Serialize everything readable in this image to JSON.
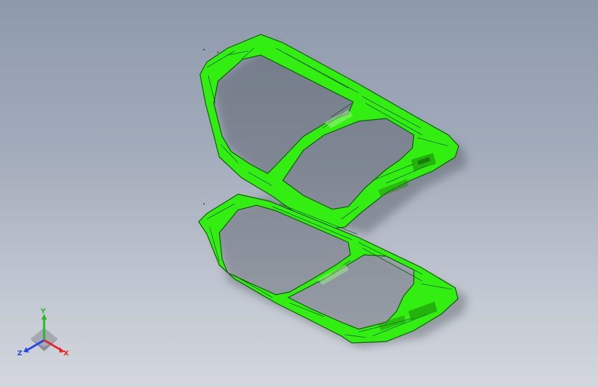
{
  "viewport": {
    "background_top": "#8e99ab",
    "background_bottom": "#d3d7dd"
  },
  "model": {
    "parts": [
      "upper-door-frame",
      "lower-door-frame"
    ],
    "color": "#33ee11",
    "edge_color": "#0b5a05"
  },
  "triad": {
    "y_label": "Y",
    "z_label": "Z",
    "x_label": "X",
    "y_color": "#22bb22",
    "z_color": "#2244ee",
    "x_color": "#ee2222"
  }
}
